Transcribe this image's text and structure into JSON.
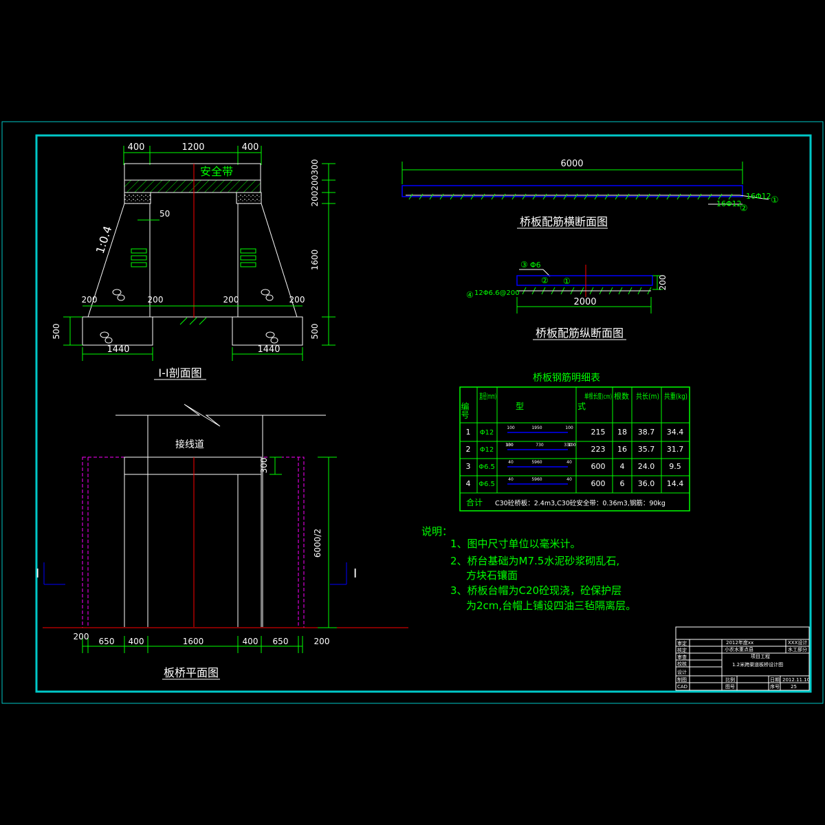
{
  "colors": {
    "background": "#000000",
    "frame": "#00c8c8",
    "line": "#ffffff",
    "dim": "#00ff00",
    "text": "#ffffff",
    "green_text": "#00ff00",
    "center_line": "#ff0000",
    "hidden": "#ff00ff",
    "blue": "#0000ff"
  },
  "section": {
    "title": "I-I剖面图",
    "band_label": "安全带",
    "slope_label": "1:0.4",
    "top_dims": [
      "400",
      "1200",
      "400"
    ],
    "right_dims": [
      "300",
      "200",
      "200",
      "1600",
      "500"
    ],
    "small_50": "50",
    "dim_200_a": "200",
    "dim_200_b": "200",
    "dim_200_c": "200",
    "dim_200_d": "200",
    "left_500": "500",
    "bottom_left": "1440",
    "bottom_right": "1440"
  },
  "cross_section": {
    "title": "桥板配筋横断面图",
    "length": "6000",
    "rebar1": "16Φ12",
    "rebar2": "16Φ12",
    "mark1": "①",
    "mark2": "②"
  },
  "long_section": {
    "title": "桥板配筋纵断面图",
    "rebar3": "Φ6",
    "rebar4": "12Φ6.6@200",
    "mark3": "③",
    "mark4": "④",
    "mark2": "②",
    "mark1": "①",
    "width": "2000",
    "height": "200"
  },
  "table": {
    "title": "桥板钢筋明细表",
    "headers": {
      "no": "编号",
      "dia": "直径(mm)",
      "shape": "式",
      "shape_top": "型",
      "len": "单根长度(cm)",
      "count": "根数",
      "total": "共长(m)",
      "weight": "共重(kg)"
    },
    "rows": [
      {
        "no": "1",
        "dia": "Φ12",
        "len": "215",
        "count": "18",
        "total": "38.7",
        "weight": "34.4",
        "shape": [
          "100",
          "1950",
          "100"
        ]
      },
      {
        "no": "2",
        "dia": "Φ12",
        "len": "223",
        "count": "16",
        "total": "35.7",
        "weight": "31.7",
        "shape": [
          "330",
          "100",
          "730",
          "330",
          "100"
        ]
      },
      {
        "no": "3",
        "dia": "Φ6.5",
        "len": "600",
        "count": "4",
        "total": "24.0",
        "weight": "9.5",
        "shape": [
          "40",
          "5960",
          "40"
        ]
      },
      {
        "no": "4",
        "dia": "Φ6.5",
        "len": "600",
        "count": "6",
        "total": "36.0",
        "weight": "14.4",
        "shape": [
          "40",
          "5960",
          "40"
        ]
      }
    ],
    "sum_label": "合计",
    "sum_text": "C30砼桥板：2.4m3,C30砼安全带：0.36m3,钢筋：90kg"
  },
  "plan": {
    "title": "板桥平面图",
    "road_label": "接线道",
    "right_dim_300": "300",
    "right_dim_half": "6000/2",
    "section_mark_left": "I",
    "section_mark_right": "I",
    "bottom_dims": [
      "200",
      "650",
      "400",
      "1600",
      "400",
      "650",
      "200"
    ]
  },
  "notes": {
    "heading": "说明：",
    "lines": [
      "1、图中尺寸单位以毫米计。",
      "2、桥台基础为M7.5水泥砂浆砌乱石,",
      "方块石镶面",
      "3、桥板台帽为C20砼现浇，砼保护层",
      "为2cm,台帽上铺设四油三毡隔离层。"
    ]
  },
  "title_block": {
    "r1a": "审定",
    "r1b": "2012年度xx",
    "r1c": "XXX设计",
    "r2a": "核定",
    "r2b": "小农水重点县",
    "r2c": "水工部分",
    "r3a": "审查",
    "r3b": "项目工程",
    "r4a": "校核",
    "r4b": "1.2米跨渠道板桥设计图",
    "r5a": "设计",
    "r6a": "制图",
    "r6b": "比例",
    "r6c": "日期",
    "r6d": "2012.11.10",
    "r7a": "CAD",
    "r7b": "图号",
    "r7c": "序号",
    "r7d": "25"
  }
}
